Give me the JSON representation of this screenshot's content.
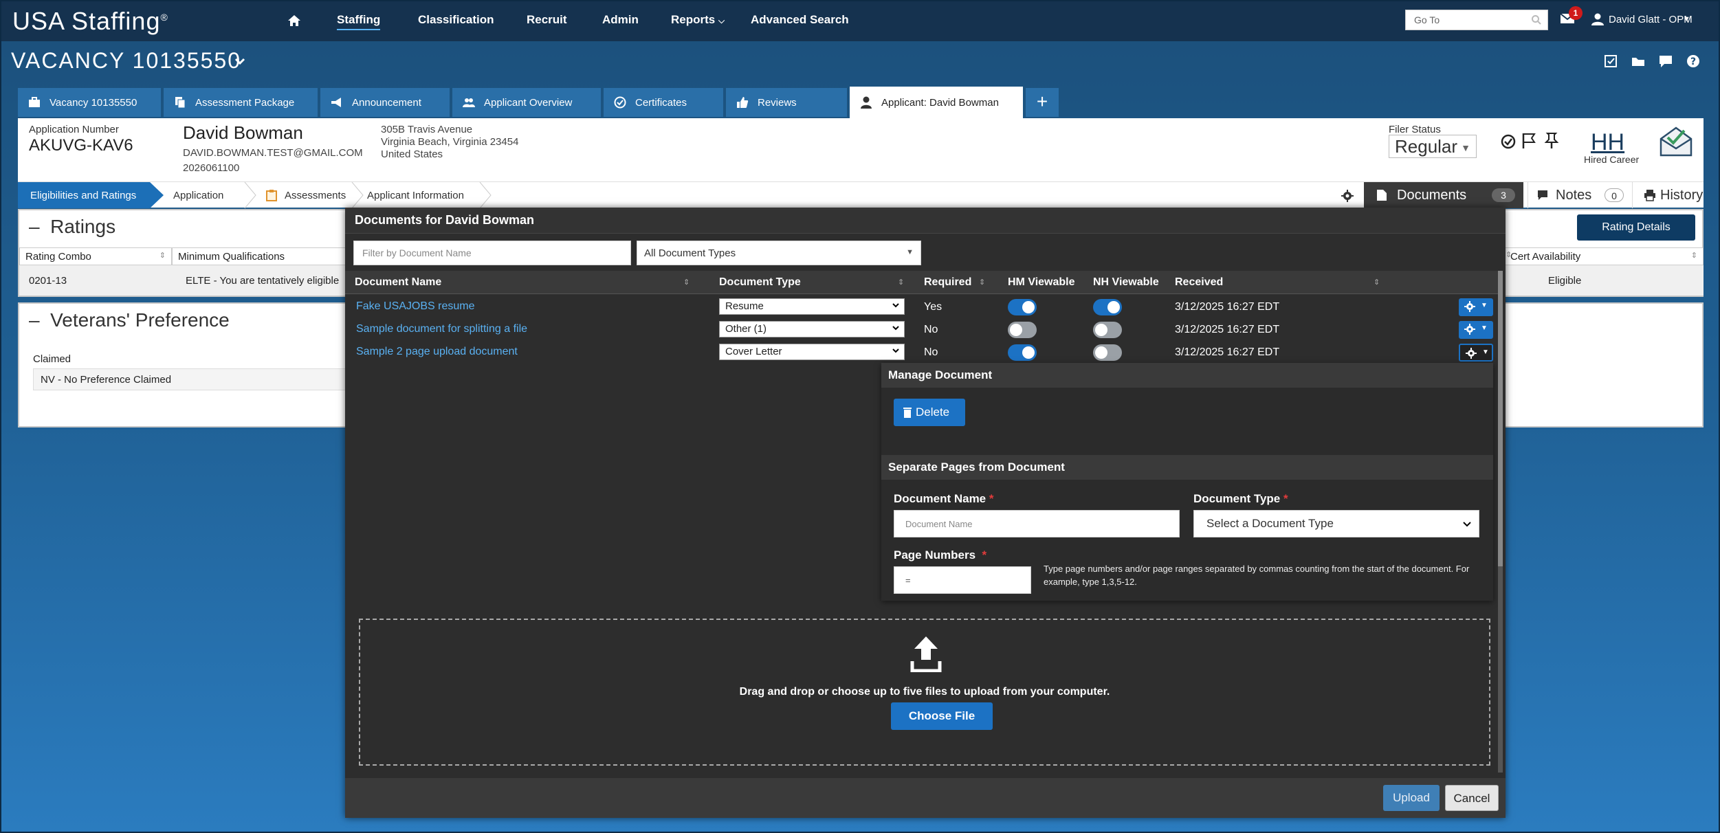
{
  "app": {
    "brand": "USA Staffing",
    "brand_mark": "®"
  },
  "nav": {
    "items": [
      "Staffing",
      "Classification",
      "Recruit",
      "Admin",
      "Reports",
      "Advanced Search"
    ],
    "active": "Staffing",
    "goto_placeholder": "Go To",
    "mail_count": "1",
    "user": "David Glatt - OPM"
  },
  "vacancy": {
    "title": "VACANCY 10135550"
  },
  "tabs": [
    {
      "label": "Vacancy 10135550",
      "icon": "briefcase-icon"
    },
    {
      "label": "Assessment Package",
      "icon": "copy-icon"
    },
    {
      "label": "Announcement",
      "icon": "megaphone-icon"
    },
    {
      "label": "Applicant Overview",
      "icon": "users-icon"
    },
    {
      "label": "Certificates",
      "icon": "check-circle-icon"
    },
    {
      "label": "Reviews",
      "icon": "thumbs-up-icon"
    },
    {
      "label": "Applicant: David Bowman",
      "icon": "user-icon",
      "active": true
    }
  ],
  "tab_add": "+",
  "applicant": {
    "app_number_label": "Application Number",
    "app_number": "AKUVG-KAV6",
    "name": "David Bowman",
    "email": "DAVID.BOWMAN.TEST@GMAIL.COM",
    "phone": "2026061100",
    "address1": "305B Travis Avenue",
    "address2": "Virginia Beach, Virginia 23454",
    "address3": "United States",
    "filer_status_label": "Filer Status",
    "filer_status": "Regular",
    "hh": "HH",
    "hh_label": "Hired Career"
  },
  "subtabs": {
    "items": [
      "Eligibilities and Ratings",
      "Application",
      "Assessments",
      "Applicant Information"
    ],
    "documents_label": "Documents",
    "documents_count": "3",
    "notes_label": "Notes",
    "notes_count": "0",
    "history_label": "History"
  },
  "ratings": {
    "title": "Ratings",
    "rating_details_button": "Rating Details",
    "columns": [
      "Rating Combo",
      "Minimum Qualifications",
      "Cert Availability"
    ],
    "row": {
      "combo": "0201-13",
      "mq": "ELTE - You are tentatively eligible",
      "cert": "Eligible"
    }
  },
  "veterans": {
    "title": "Veterans' Preference",
    "claimed_label": "Claimed",
    "claimed_value": "NV - No Preference Claimed"
  },
  "modal": {
    "title": "Documents for David Bowman",
    "filter_placeholder": "Filter by Document Name",
    "type_filter": "All Document Types",
    "columns": [
      "Document Name",
      "Document Type",
      "Required",
      "HM Viewable",
      "NH Viewable",
      "Received"
    ],
    "documents": [
      {
        "name": "Fake USAJOBS resume",
        "type": "Resume",
        "required": "Yes",
        "hm": true,
        "nh": true,
        "received": "3/12/2025 16:27 EDT"
      },
      {
        "name": "Sample document for splitting a file",
        "type": "Other (1)",
        "required": "No",
        "hm": false,
        "nh": false,
        "received": "3/12/2025 16:27 EDT"
      },
      {
        "name": "Sample 2 page upload document",
        "type": "Cover Letter",
        "required": "No",
        "hm": true,
        "nh": false,
        "received": "3/12/2025 16:27 EDT"
      }
    ],
    "manage": {
      "title": "Manage Document",
      "delete_label": "Delete",
      "separate_title": "Separate Pages from Document",
      "doc_name_label": "Document Name",
      "doc_name_placeholder": "Document Name",
      "doc_type_label": "Document Type",
      "doc_type_placeholder": "Select a Document Type",
      "page_numbers_label": "Page Numbers",
      "page_numbers_value": "=",
      "hint": "Type page numbers and/or page ranges separated by commas counting from the start of the document. For example, type 1,3,5-12.",
      "required_mark": "*"
    },
    "upload": {
      "drop_text": "Drag and drop or choose up to five files to upload from your computer.",
      "choose_label": "Choose File",
      "upload_label": "Upload",
      "cancel_label": "Cancel"
    }
  },
  "colors": {
    "nav_bg": "#15324f",
    "accent": "#1c72c4",
    "link": "#5ab1f2",
    "modal_bg": "#2d2d2d"
  }
}
